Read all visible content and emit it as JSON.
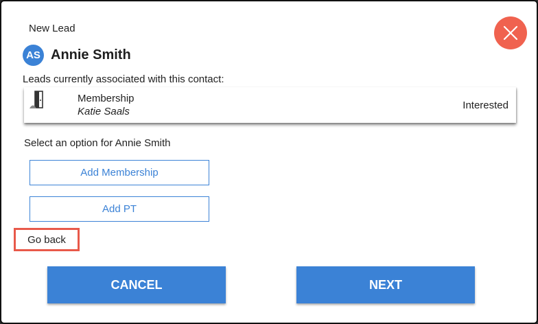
{
  "header": {
    "title": "New Lead",
    "close_icon": "close-x-icon"
  },
  "contact": {
    "initials": "AS",
    "name": "Annie Smith",
    "avatar_color": "#3b82d6"
  },
  "leads": {
    "label": "Leads currently associated with this contact:",
    "items": [
      {
        "icon": "membership-door-icon",
        "type": "Membership",
        "owner": "Katie Saals",
        "status": "Interested"
      }
    ]
  },
  "options": {
    "label": "Select an option for Annie Smith",
    "add_membership": "Add Membership",
    "add_pt": "Add PT"
  },
  "go_back": "Go back",
  "actions": {
    "cancel": "CANCEL",
    "next": "NEXT"
  },
  "colors": {
    "accent": "#3b82d6",
    "close": "#f0624f",
    "highlight": "#e8594a"
  }
}
